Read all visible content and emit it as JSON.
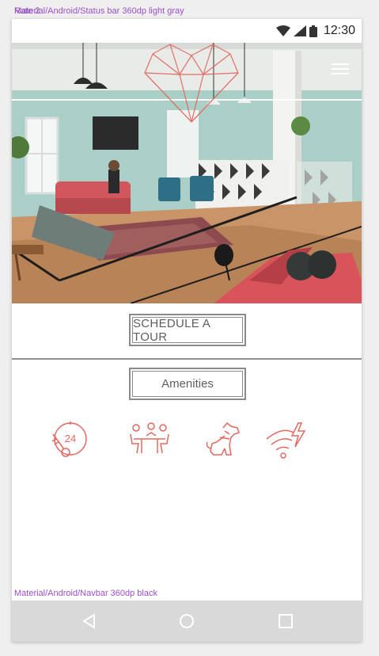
{
  "frame": {
    "label": "Material/Android/Status bar 360dp light gray",
    "overlapping_label": "Rate 2"
  },
  "statusbar": {
    "time": "12:30",
    "icons": [
      "wifi-icon",
      "signal-icon",
      "battery-icon"
    ]
  },
  "header": {
    "logo": "geometric-heart-logo",
    "menu_icon": "hamburger-menu-icon"
  },
  "hero": {
    "image": "loft-lounge-photo"
  },
  "actions": {
    "schedule_label": "SCHEDULE A TOUR",
    "amenities_label": "Amenities"
  },
  "amenities": {
    "icons": [
      "24-hour-key-access-icon",
      "coworking-lounge-icon",
      "pet-friendly-dog-icon",
      "high-speed-wifi-icon"
    ]
  },
  "navbar": {
    "label": "Material/Android/Navbar 360dp black",
    "buttons": [
      "back-icon",
      "home-icon",
      "recents-icon"
    ]
  },
  "colors": {
    "accent": "#e4685f",
    "button_border": "#8a8a8a",
    "button_text": "#5e5e5e",
    "navbar_bg": "#d9d9d9",
    "annotation": "#9b4fc9"
  }
}
